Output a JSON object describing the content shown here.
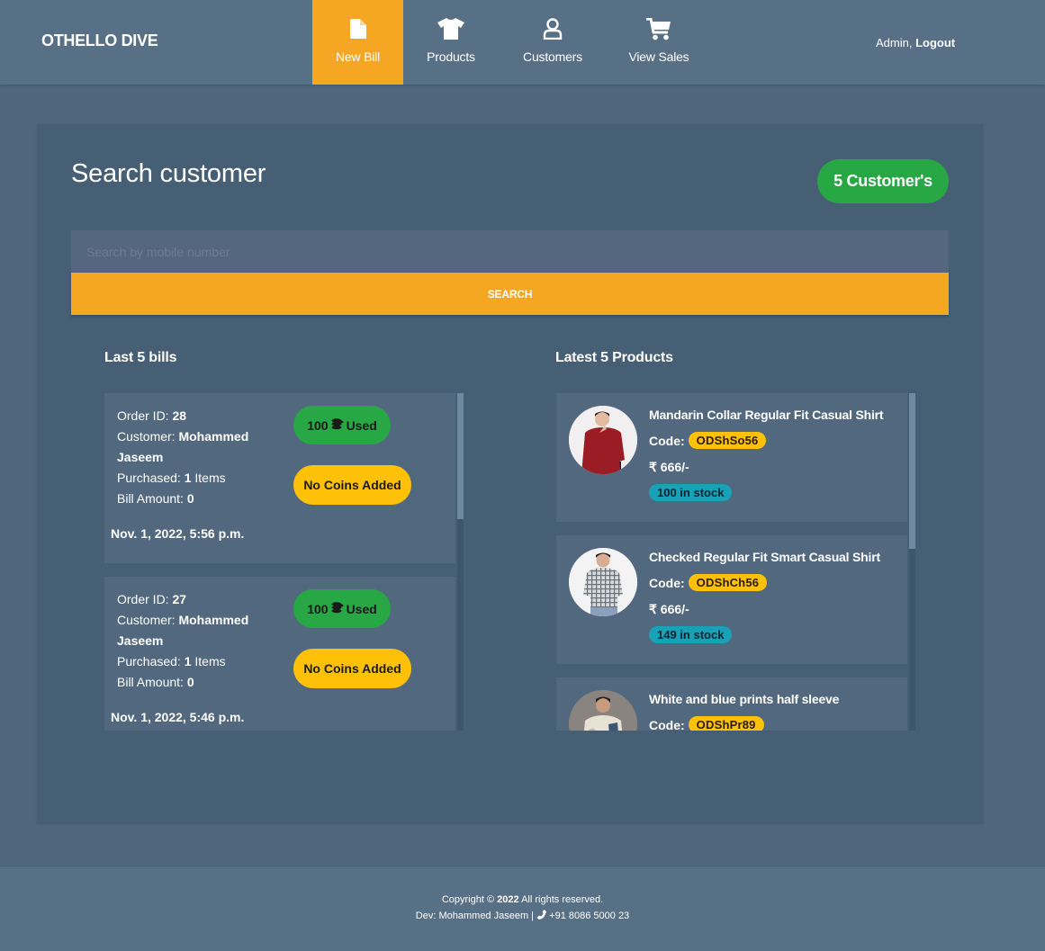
{
  "app": {
    "brand": "OTHELLO DIVE"
  },
  "nav": {
    "items": [
      {
        "label": "New Bill",
        "icon": "file-icon",
        "active": true
      },
      {
        "label": "Products",
        "icon": "tshirt-icon",
        "active": false
      },
      {
        "label": "Customers",
        "icon": "user-icon",
        "active": false
      },
      {
        "label": "View Sales",
        "icon": "cart-icon",
        "active": false
      }
    ],
    "user": "Admin,",
    "logout": "Logout"
  },
  "main": {
    "title": "Search customer",
    "customer_count_badge": "5 Customer's",
    "search": {
      "placeholder": "Search by mobile number",
      "value": "",
      "button_label": "SEARCH"
    }
  },
  "bills": {
    "title": "Last 5 bills",
    "labels": {
      "order_id": "Order ID:",
      "customer": "Customer:",
      "purchased": "Purchased:",
      "items_suffix": "Items",
      "bill_amount": "Bill Amount:"
    },
    "items": [
      {
        "order_id": "28",
        "customer": "Mohammed Jaseem",
        "purchased": "1",
        "bill_amount": "0",
        "coins_used_value": "100",
        "coins_used_suffix": "Used",
        "coins_added": "No Coins Added",
        "date": "Nov. 1, 2022, 5:56 p.m."
      },
      {
        "order_id": "27",
        "customer": "Mohammed Jaseem",
        "purchased": "1",
        "bill_amount": "0",
        "coins_used_value": "100",
        "coins_used_suffix": "Used",
        "coins_added": "No Coins Added",
        "date": "Nov. 1, 2022, 5:46 p.m."
      }
    ]
  },
  "products": {
    "title": "Latest 5 Products",
    "code_label": "Code:",
    "items": [
      {
        "name": "Mandarin Collar Regular Fit Casual Shirt",
        "code": "ODShSo56",
        "price": "₹ 666/-",
        "stock": "100 in stock",
        "shirt_color": "#9b1c24"
      },
      {
        "name": "Checked Regular Fit Smart Casual Shirt",
        "code": "ODShCh56",
        "price": "₹ 666/-",
        "stock": "149 in stock",
        "shirt_color": "#c9ccd0"
      },
      {
        "name": "White and blue prints half sleeve",
        "code": "ODShPr89",
        "price": "",
        "stock": "",
        "shirt_color": "#e8e2d4"
      }
    ]
  },
  "footer": {
    "copyright_prefix": "Copyright ©",
    "year": "2022",
    "copyright_suffix": "All rights reserved.",
    "dev": "Dev: Mohammed Jaseem |",
    "phone": "+91 8086 5000 23"
  },
  "colors": {
    "accent": "#f5a623",
    "success": "#28a745",
    "warning": "#ffc107",
    "info": "#17a2b8",
    "navbar": "#587085",
    "card": "#465f74"
  }
}
